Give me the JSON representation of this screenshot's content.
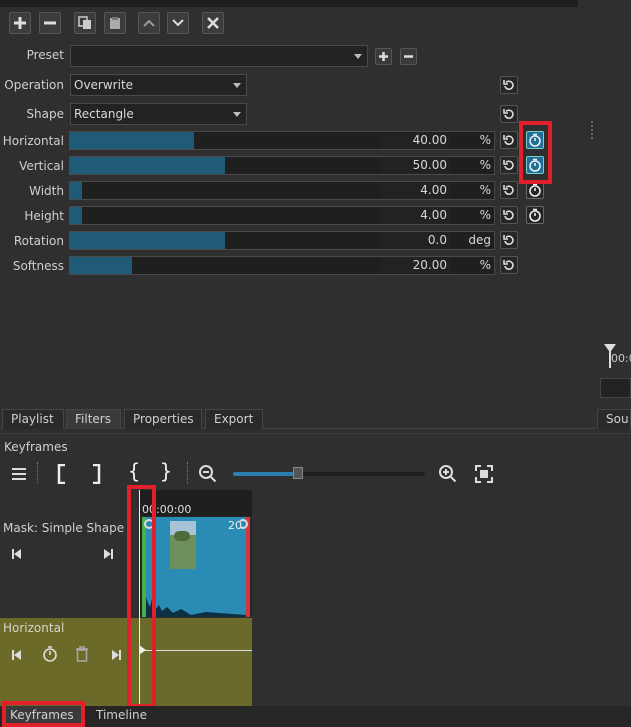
{
  "filter_params": {
    "preset": {
      "label": "Preset",
      "value": ""
    },
    "operation": {
      "label": "Operation",
      "value": "Overwrite"
    },
    "shape": {
      "label": "Shape",
      "value": "Rectangle"
    },
    "sliders": [
      {
        "label": "Horizontal",
        "value": "40.00",
        "unit": "%",
        "fraction": 0.4,
        "keyframes_on": true
      },
      {
        "label": "Vertical",
        "value": "50.00",
        "unit": "%",
        "fraction": 0.5,
        "keyframes_on": true
      },
      {
        "label": "Width",
        "value": "4.00",
        "unit": "%",
        "fraction": 0.04,
        "keyframes_on": false
      },
      {
        "label": "Height",
        "value": "4.00",
        "unit": "%",
        "fraction": 0.04,
        "keyframes_on": false
      },
      {
        "label": "Rotation",
        "value": "0.0",
        "unit": "deg",
        "fraction": 0.5,
        "keyframes_on": null
      },
      {
        "label": "Softness",
        "value": "20.00",
        "unit": "%",
        "fraction": 0.2,
        "keyframes_on": null
      }
    ]
  },
  "right_panel": {
    "timecode": "00:0",
    "tab_partial": "Sou"
  },
  "panel_tabs": [
    "Playlist",
    "Filters",
    "Properties",
    "Export"
  ],
  "keyframes": {
    "title": "Keyframes",
    "timecode": "00:00:00",
    "clip_label": "20",
    "track_name": "Mask: Simple Shape",
    "param_track": "Horizontal"
  },
  "bottom_tabs": [
    "Keyframes",
    "Timeline"
  ],
  "colors": {
    "accent": "#1f5a76",
    "highlight_red": "#e0202a",
    "param_track_bg": "#6b6a28",
    "clip_blue": "#2a8cb5"
  }
}
